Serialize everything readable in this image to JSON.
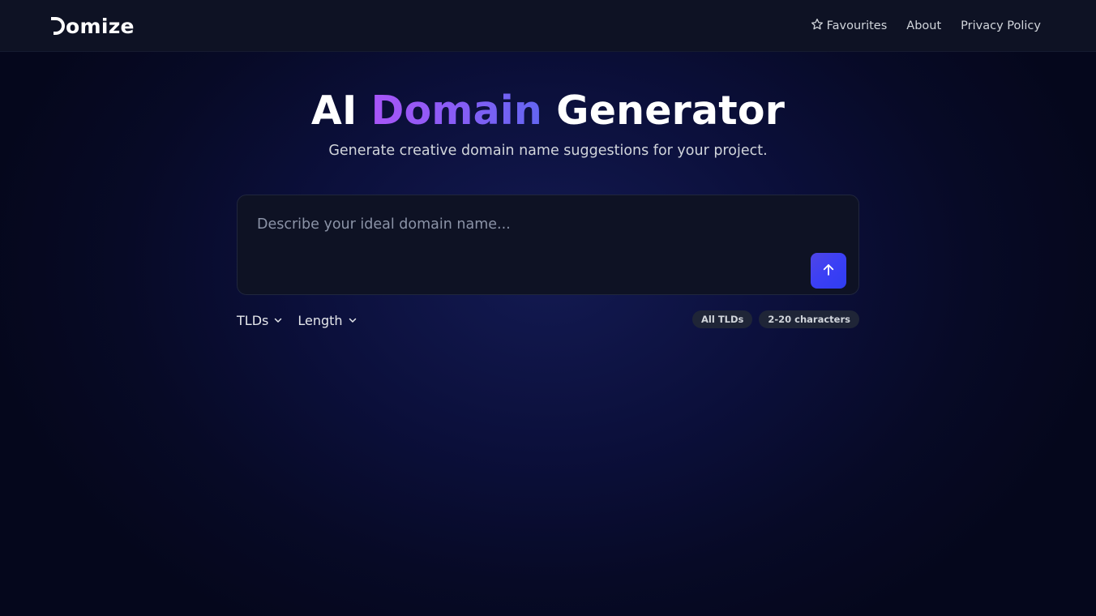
{
  "header": {
    "logo_text": "omize",
    "nav": [
      {
        "label": "Favourites",
        "icon": "star-icon"
      },
      {
        "label": "About"
      },
      {
        "label": "Privacy Policy"
      }
    ]
  },
  "hero": {
    "title_before": "AI ",
    "title_highlight": "Domain",
    "title_after": " Generator",
    "subtitle": "Generate creative domain name suggestions for your project."
  },
  "prompt": {
    "value": "",
    "placeholder": "Describe your ideal domain name...",
    "submit_icon": "arrow-up-icon"
  },
  "filters": [
    {
      "label": "TLDs",
      "icon": "chevron-down-icon"
    },
    {
      "label": "Length",
      "icon": "chevron-down-icon"
    }
  ],
  "badges": [
    {
      "label": "All TLDs"
    },
    {
      "label": "2-20 characters"
    }
  ],
  "colors": {
    "accent": "#3b3ff5",
    "gradient_start": "#a855f7",
    "gradient_end": "#6366f1",
    "background": "#0b0f3a"
  }
}
